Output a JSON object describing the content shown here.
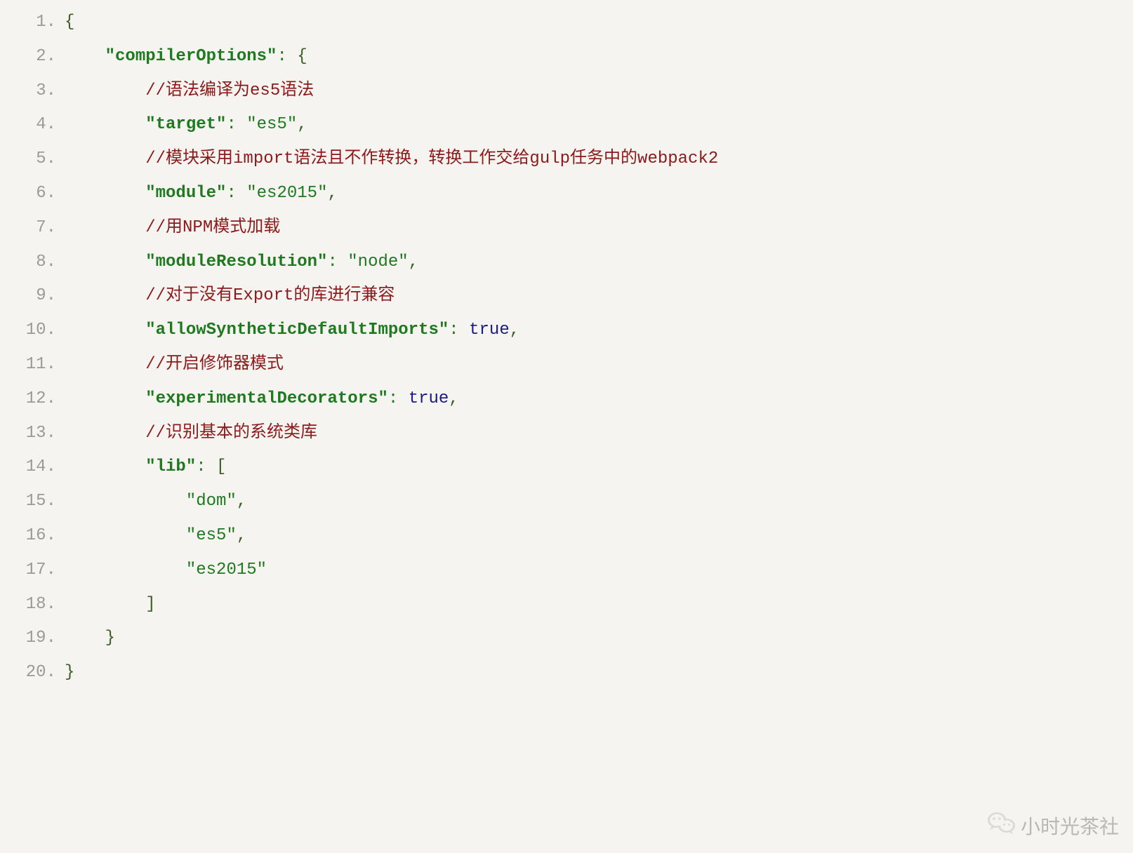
{
  "watermark": "小时光茶社",
  "lines": [
    {
      "no": "1.",
      "indent": 0,
      "tokens": [
        {
          "cls": "brkt",
          "t": "{"
        }
      ]
    },
    {
      "no": "2.",
      "indent": 1,
      "tokens": [
        {
          "cls": "key",
          "t": "\"compilerOptions\""
        },
        {
          "cls": "punct",
          "t": ":"
        },
        {
          "cls": "",
          "t": " "
        },
        {
          "cls": "brkt",
          "t": "{"
        }
      ]
    },
    {
      "no": "3.",
      "indent": 2,
      "tokens": [
        {
          "cls": "cmt",
          "t": "//语法编译为es5语法"
        }
      ]
    },
    {
      "no": "4.",
      "indent": 2,
      "tokens": [
        {
          "cls": "key",
          "t": "\"target\""
        },
        {
          "cls": "punct",
          "t": ":"
        },
        {
          "cls": "",
          "t": " "
        },
        {
          "cls": "str",
          "t": "\"es5\""
        },
        {
          "cls": "comma",
          "t": ","
        }
      ]
    },
    {
      "no": "5.",
      "indent": 2,
      "tokens": [
        {
          "cls": "cmt",
          "t": "//模块采用import语法且不作转换，转换工作交给gulp任务中的webpack2"
        }
      ]
    },
    {
      "no": "6.",
      "indent": 2,
      "tokens": [
        {
          "cls": "key",
          "t": "\"module\""
        },
        {
          "cls": "punct",
          "t": ":"
        },
        {
          "cls": "",
          "t": " "
        },
        {
          "cls": "str",
          "t": "\"es2015\""
        },
        {
          "cls": "comma",
          "t": ","
        }
      ]
    },
    {
      "no": "7.",
      "indent": 2,
      "tokens": [
        {
          "cls": "cmt",
          "t": "//用NPM模式加载"
        }
      ]
    },
    {
      "no": "8.",
      "indent": 2,
      "tokens": [
        {
          "cls": "key",
          "t": "\"moduleResolution\""
        },
        {
          "cls": "punct",
          "t": ":"
        },
        {
          "cls": "",
          "t": " "
        },
        {
          "cls": "str",
          "t": "\"node\""
        },
        {
          "cls": "comma",
          "t": ","
        }
      ]
    },
    {
      "no": "9.",
      "indent": 2,
      "tokens": [
        {
          "cls": "cmt",
          "t": "//对于没有Export的库进行兼容"
        }
      ]
    },
    {
      "no": "10.",
      "indent": 2,
      "tokens": [
        {
          "cls": "key",
          "t": "\"allowSyntheticDefaultImports\""
        },
        {
          "cls": "punct",
          "t": ":"
        },
        {
          "cls": "",
          "t": " "
        },
        {
          "cls": "bool",
          "t": "true"
        },
        {
          "cls": "comma",
          "t": ","
        }
      ]
    },
    {
      "no": "11.",
      "indent": 2,
      "tokens": [
        {
          "cls": "cmt",
          "t": "//开启修饰器模式"
        }
      ]
    },
    {
      "no": "12.",
      "indent": 2,
      "tokens": [
        {
          "cls": "key",
          "t": "\"experimentalDecorators\""
        },
        {
          "cls": "punct",
          "t": ":"
        },
        {
          "cls": "",
          "t": " "
        },
        {
          "cls": "bool",
          "t": "true"
        },
        {
          "cls": "comma",
          "t": ","
        }
      ]
    },
    {
      "no": "13.",
      "indent": 2,
      "tokens": [
        {
          "cls": "cmt",
          "t": "//识别基本的系统类库"
        }
      ]
    },
    {
      "no": "14.",
      "indent": 2,
      "tokens": [
        {
          "cls": "key",
          "t": "\"lib\""
        },
        {
          "cls": "punct",
          "t": ":"
        },
        {
          "cls": "",
          "t": " "
        },
        {
          "cls": "brkt",
          "t": "["
        }
      ]
    },
    {
      "no": "15.",
      "indent": 3,
      "tokens": [
        {
          "cls": "str",
          "t": "\"dom\""
        },
        {
          "cls": "comma",
          "t": ","
        }
      ]
    },
    {
      "no": "16.",
      "indent": 3,
      "tokens": [
        {
          "cls": "str",
          "t": "\"es5\""
        },
        {
          "cls": "comma",
          "t": ","
        }
      ]
    },
    {
      "no": "17.",
      "indent": 3,
      "tokens": [
        {
          "cls": "str",
          "t": "\"es2015\""
        }
      ]
    },
    {
      "no": "18.",
      "indent": 2,
      "tokens": [
        {
          "cls": "brkt",
          "t": "]"
        }
      ]
    },
    {
      "no": "19.",
      "indent": 1,
      "tokens": [
        {
          "cls": "brkt",
          "t": "}"
        }
      ]
    },
    {
      "no": "20.",
      "indent": 0,
      "tokens": [
        {
          "cls": "brkt",
          "t": "}"
        }
      ]
    }
  ]
}
